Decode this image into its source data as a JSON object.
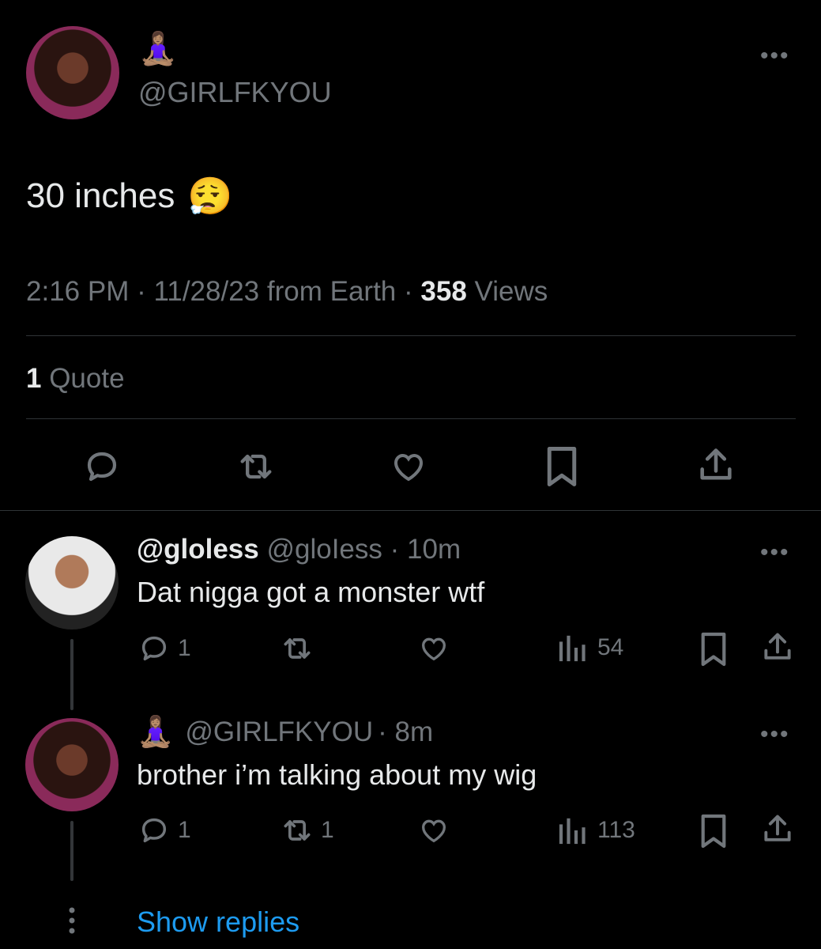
{
  "main_tweet": {
    "author_emoji": "🧘🏽‍♀️",
    "handle": "@GIRLFKYOU",
    "text": "30 inches",
    "text_emoji": "😮‍💨",
    "meta": {
      "time": "2:16 PM",
      "sep1": "·",
      "date": "11/28/23",
      "source": "from Earth",
      "sep2": "·",
      "views_count": "358",
      "views_label": "Views"
    },
    "quotes": {
      "count": "1",
      "label": "Quote"
    },
    "actions": [
      "reply-icon",
      "retweet-icon",
      "like-icon",
      "bookmark-icon",
      "share-icon"
    ]
  },
  "replies": [
    {
      "display_name": "@gloless",
      "handle": "@gloIess",
      "time": "· 10m",
      "text": "Dat nigga got a monster wtf",
      "reply_count": "1",
      "retweet_count": "",
      "views": "54"
    },
    {
      "author_emoji": "🧘🏽‍♀️",
      "handle": "@GIRLFKYOU",
      "time": "· 8m",
      "text": "brother i’m talking about my wig",
      "reply_count": "1",
      "retweet_count": "1",
      "views": "113"
    }
  ],
  "show_replies": "Show replies",
  "more_glyph": "•••",
  "colors": {
    "background": "#000000",
    "text": "#e7e9ea",
    "muted": "#71767b",
    "link": "#1d9bf0"
  }
}
